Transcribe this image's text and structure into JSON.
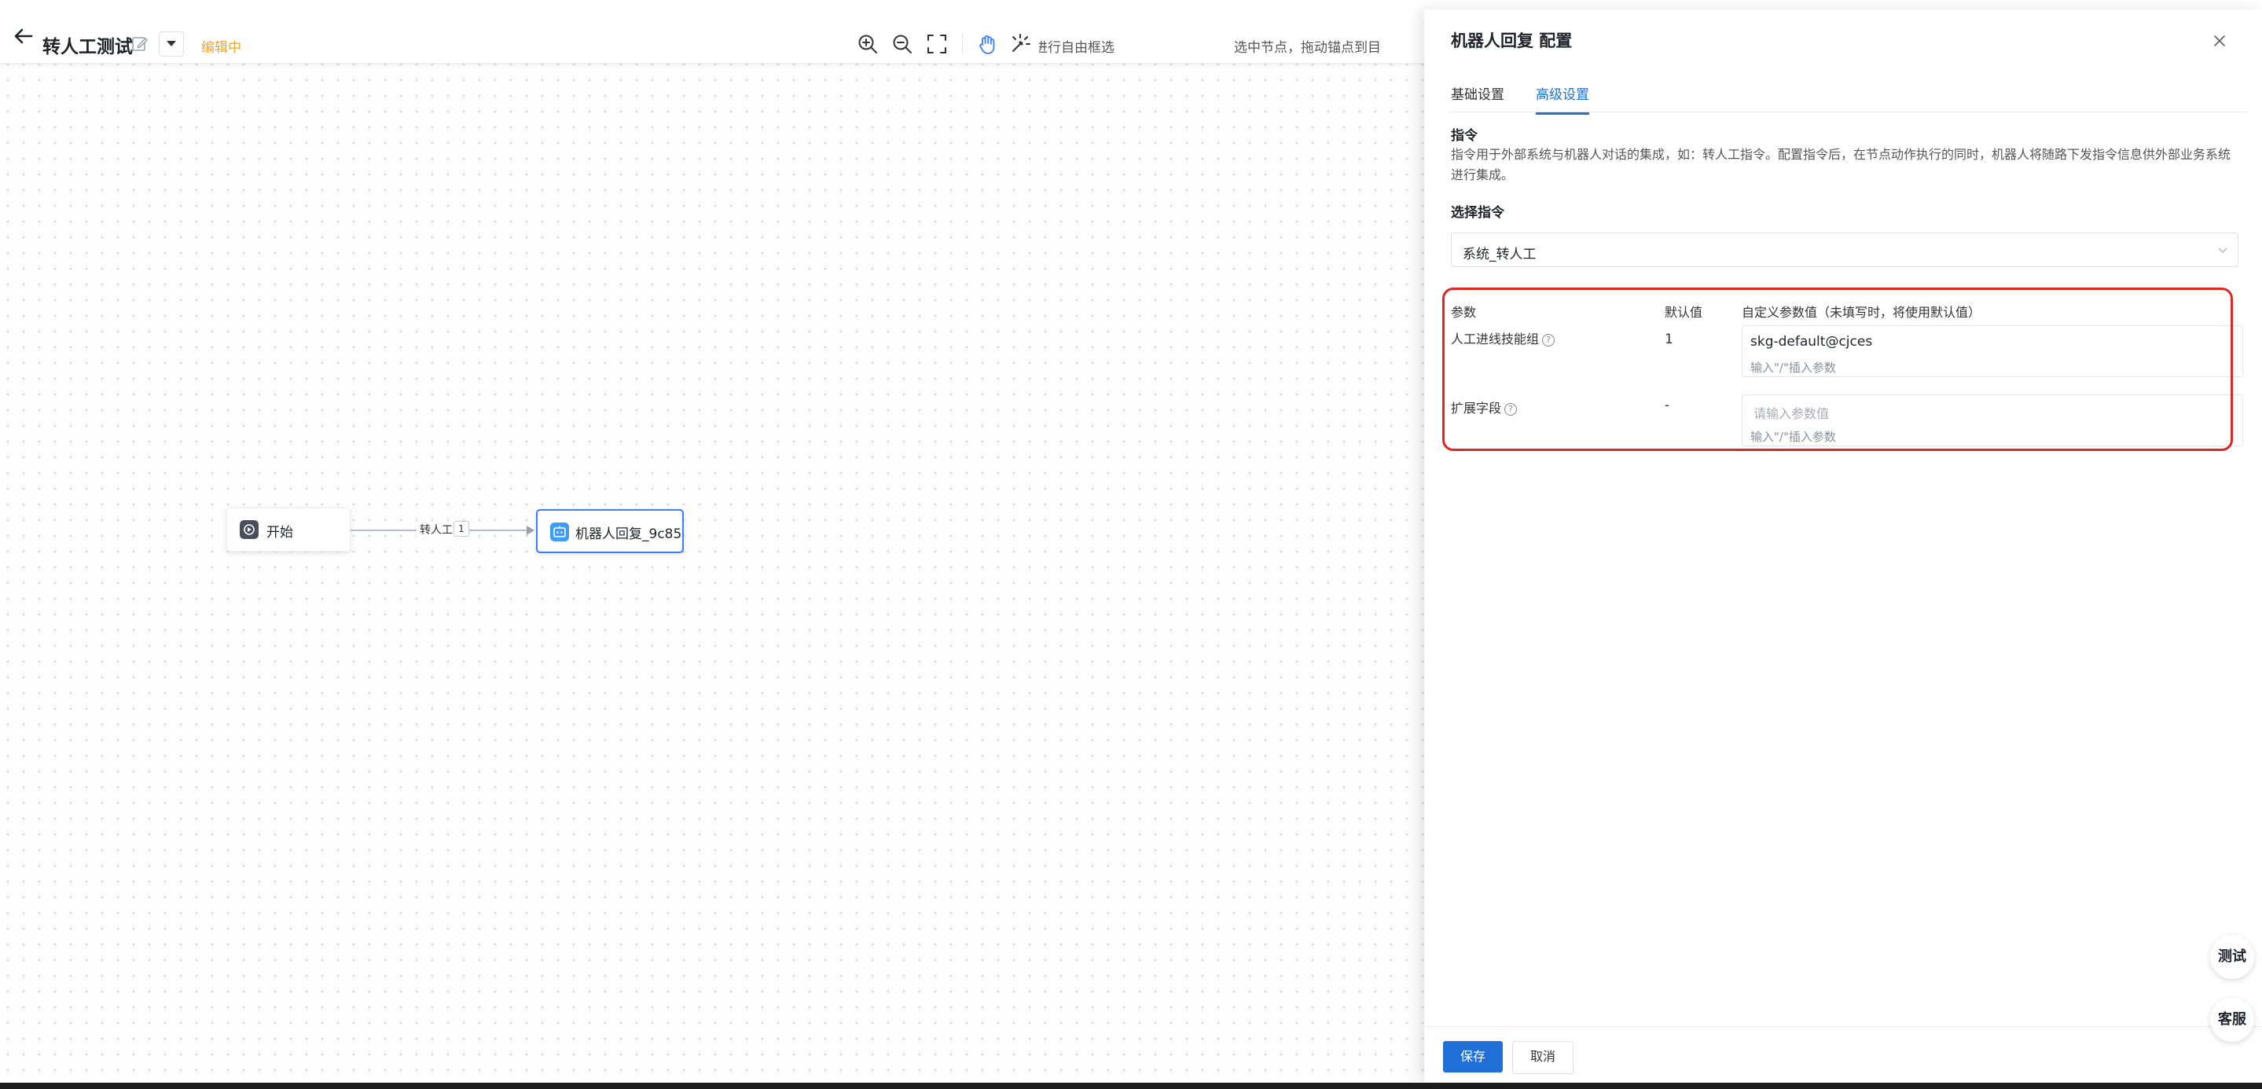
{
  "header": {
    "flow_title": "转人工测试",
    "status": "编辑中",
    "tool_hint_select": "进行自由框选",
    "tool_hint_anchor": "选中节点，拖动锚点到目标"
  },
  "canvas": {
    "nodes": [
      {
        "label": "开始"
      },
      {
        "label": "机器人回复_9c85"
      }
    ],
    "edge": {
      "label": "转人工",
      "count": "1"
    }
  },
  "drawer": {
    "title": "机器人回复 配置",
    "tabs": [
      {
        "label": "基础设置"
      },
      {
        "label": "高级设置"
      }
    ],
    "section_title": "指令",
    "section_desc": "指令用于外部系统与机器人对话的集成，如：转人工指令。配置指令后，在节点动作执行的同时，机器人将随路下发指令信息供外部业务系统进行集成。",
    "select_label": "选择指令",
    "select_value": "系统_转人工",
    "table": {
      "headers": {
        "param": "参数",
        "default": "默认值",
        "custom": "自定义参数值（未填写时，将使用默认值）"
      },
      "rows": [
        {
          "name": "人工进线技能组",
          "default": "1",
          "value": "skg-default@cjces",
          "placeholder": "",
          "hint": "输入\"/\"插入参数"
        },
        {
          "name": "扩展字段",
          "default": "-",
          "value": "",
          "placeholder": "请输入参数值",
          "hint": "输入\"/\"插入参数"
        }
      ]
    },
    "footer": {
      "save": "保存",
      "cancel": "取消"
    }
  },
  "floating": {
    "test": "测试",
    "service": "客服"
  },
  "colors": {
    "primary": "#1f6fd6",
    "status": "#f5a623",
    "highlight": "#e02525"
  }
}
